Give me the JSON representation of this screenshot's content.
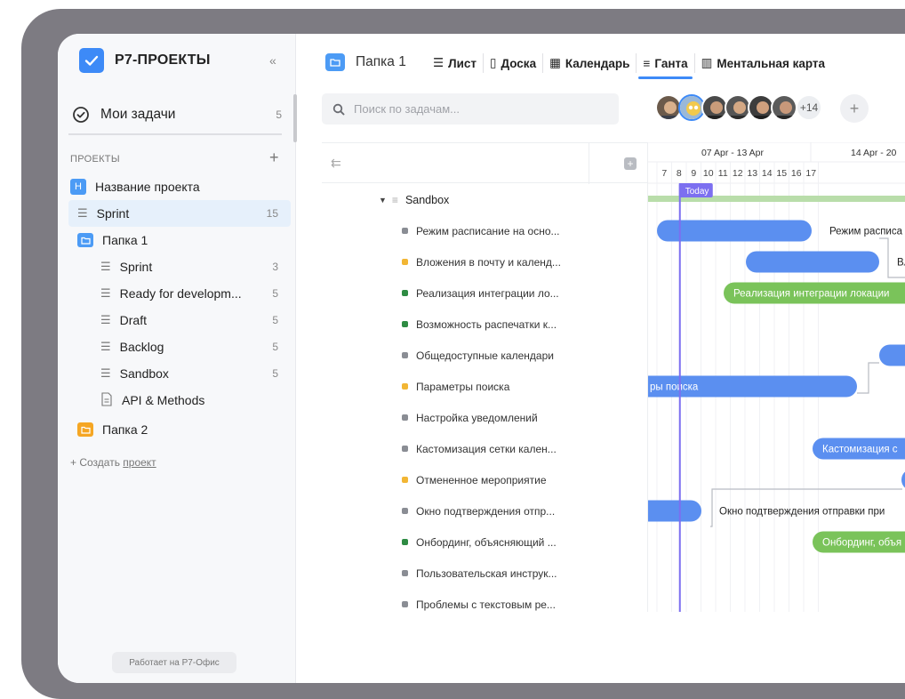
{
  "app": {
    "name": "Р7-ПРОЕКТЫ",
    "collapse_glyph": "«",
    "powered_by": "Работает на Р7-Офис"
  },
  "sidebar": {
    "my_tasks": {
      "label": "Мои задачи",
      "count": "5"
    },
    "projects_header": "ПРОЕКТЫ",
    "project": {
      "badge": "Н",
      "name": "Название проекта"
    },
    "items": [
      {
        "label": "Sprint",
        "count": "15",
        "level": 0,
        "icon": "list-icon",
        "active": true
      },
      {
        "label": "Папка 1",
        "count": "",
        "level": 0,
        "icon": "folder-icon",
        "color": "#4c9bf5"
      },
      {
        "label": "Sprint",
        "count": "3",
        "level": 1,
        "icon": "list-icon"
      },
      {
        "label": "Ready for developm...",
        "count": "5",
        "level": 1,
        "icon": "list-icon"
      },
      {
        "label": "Draft",
        "count": "5",
        "level": 1,
        "icon": "list-icon"
      },
      {
        "label": "Backlog",
        "count": "5",
        "level": 1,
        "icon": "list-icon"
      },
      {
        "label": "Sandbox",
        "count": "5",
        "level": 1,
        "icon": "list-icon"
      },
      {
        "label": "API & Methods",
        "count": "",
        "level": 1,
        "icon": "doc-icon"
      },
      {
        "label": "Папка 2",
        "count": "",
        "level": 0,
        "icon": "folder-icon",
        "color": "#f5a623"
      }
    ],
    "create_prefix": "+ Создать ",
    "create_link": "проект"
  },
  "toolbar": {
    "folder_name": "Папка 1",
    "views": [
      {
        "label": "Лист",
        "icon": "☰",
        "active": false
      },
      {
        "label": "Доска",
        "icon": "▯",
        "active": false
      },
      {
        "label": "Календарь",
        "icon": "▦",
        "active": false
      },
      {
        "label": "Ганта",
        "icon": "≡",
        "active": true
      },
      {
        "label": "Ментальная карта",
        "icon": "▥",
        "active": false
      }
    ]
  },
  "search": {
    "placeholder": "Поиск по задачам..."
  },
  "members": {
    "more": "+14",
    "add": "+"
  },
  "gantt": {
    "group": "Sandbox",
    "weeks": [
      "07 Apr - 13 Apr",
      "14 Apr - 20"
    ],
    "days": [
      "7",
      "8",
      "9",
      "10",
      "11",
      "12",
      "13",
      "14",
      "15",
      "16",
      "17"
    ],
    "today_label": "Today",
    "tasks": [
      {
        "name": "Режим расписание на осно...",
        "status": "#8a8d94",
        "bar_label": "Режим расписа"
      },
      {
        "name": "Вложения в почту и календ...",
        "status": "#f2b634",
        "bar_label": "Вл"
      },
      {
        "name": "Реализация интеграции ло...",
        "status": "#2e8b43",
        "bar_label": "Реализация интеграции локации"
      },
      {
        "name": "Возможность распечатки к...",
        "status": "#2e8b43",
        "bar_label": ""
      },
      {
        "name": "Общедоступные календари",
        "status": "#8a8d94",
        "bar_label": ""
      },
      {
        "name": "Параметры поиска",
        "status": "#f2b634",
        "bar_label": "ры поиска"
      },
      {
        "name": "Настройка уведомлений",
        "status": "#8a8d94",
        "bar_label": ""
      },
      {
        "name": "Кастомизация сетки кален...",
        "status": "#8a8d94",
        "bar_label": "Кастомизация с"
      },
      {
        "name": "Отмененное мероприятие",
        "status": "#f2b634",
        "bar_label": ""
      },
      {
        "name": "Окно подтверждения отпр...",
        "status": "#8a8d94",
        "bar_label": "Окно подтверждения отправки при"
      },
      {
        "name": "Онбординг, объясняющий ...",
        "status": "#2e8b43",
        "bar_label": "Онбординг, объя"
      },
      {
        "name": "Пользовательская инструк...",
        "status": "#8a8d94",
        "bar_label": ""
      },
      {
        "name": "Проблемы с текстовым ре...",
        "status": "#8a8d94",
        "bar_label": ""
      }
    ]
  },
  "colors": {
    "accent": "#3d8af7",
    "bar_blue": "#5b8ff0",
    "bar_green": "#7ac35a",
    "today": "#7c6ff0",
    "frame": "#7d7b82"
  }
}
